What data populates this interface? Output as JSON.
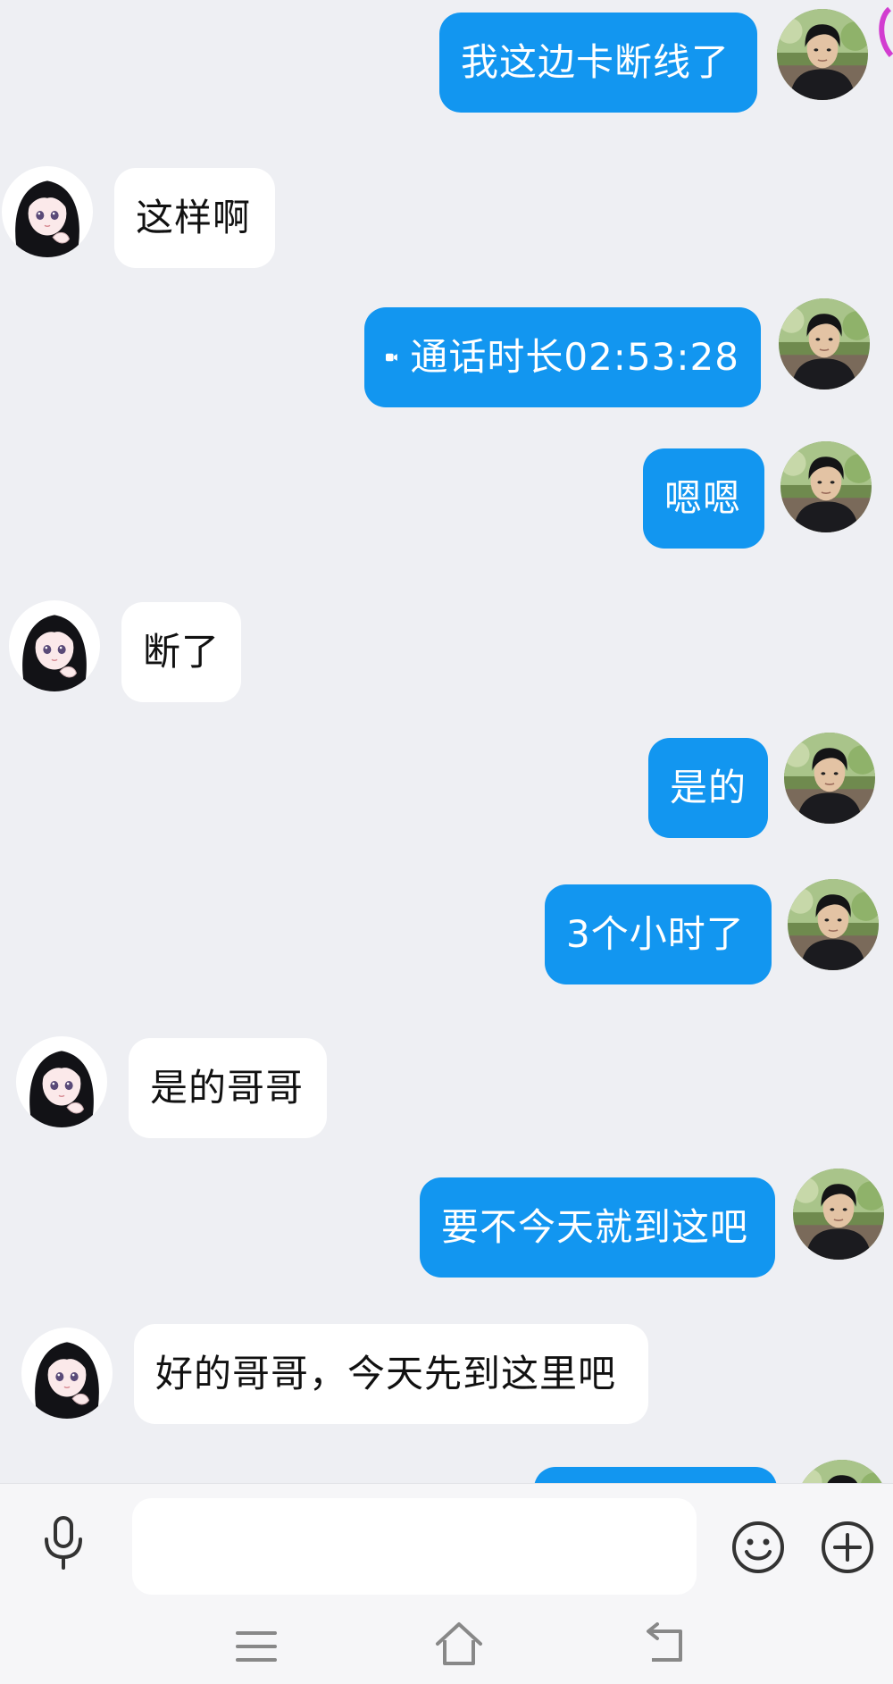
{
  "messages": [
    {
      "dir": "out",
      "text": "我这边卡断线了"
    },
    {
      "dir": "in",
      "text": "这样啊"
    },
    {
      "dir": "out",
      "type": "call",
      "icon": "video-call-icon",
      "text": "通话时长02:53:28"
    },
    {
      "dir": "out",
      "text": "嗯嗯"
    },
    {
      "dir": "in",
      "text": "断了"
    },
    {
      "dir": "out",
      "text": "是的"
    },
    {
      "dir": "out",
      "text": "3个小时了"
    },
    {
      "dir": "in",
      "text": "是的哥哥"
    },
    {
      "dir": "out",
      "text": "要不今天就到这吧"
    },
    {
      "dir": "in",
      "text": "好的哥哥，今天先到这里吧"
    },
    {
      "dir": "out",
      "text": ""
    }
  ],
  "input_bar": {
    "value": "",
    "placeholder": "",
    "icons": [
      "microphone-icon",
      "emoji-icon",
      "plus-icon"
    ]
  },
  "nav_bar": {
    "icons": [
      "menu-icon",
      "home-icon",
      "back-icon"
    ]
  },
  "colors": {
    "background": "#eeeff3",
    "outgoing_bubble": "#1296f0",
    "incoming_bubble": "#ffffff",
    "icon": "#333333"
  }
}
